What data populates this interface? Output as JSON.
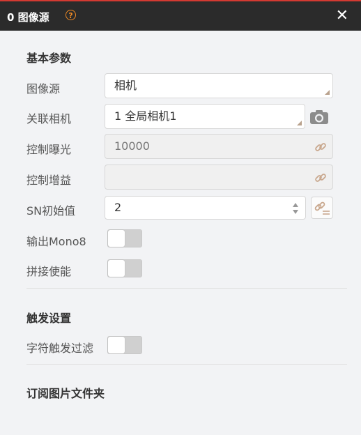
{
  "header": {
    "title": "0 图像源",
    "help_icon": "?",
    "close_icon": "✕"
  },
  "sections": {
    "basic": "基本参数",
    "trigger": "触发设置",
    "subscribe": "订阅图片文件夹"
  },
  "fields": {
    "image_source": {
      "label": "图像源",
      "value": "相机"
    },
    "camera": {
      "label": "关联相机",
      "value": "1 全局相机1"
    },
    "exposure": {
      "label": "控制曝光",
      "value": "10000"
    },
    "gain": {
      "label": "控制增益",
      "value": ""
    },
    "sn": {
      "label": "SN初始值",
      "value": "2"
    },
    "mono8": {
      "label": "输出Mono8",
      "on": false
    },
    "stitch": {
      "label": "拼接使能",
      "on": false
    },
    "char_filter": {
      "label": "字符触发过滤",
      "on": false
    }
  },
  "colors": {
    "accent": "#f08a24",
    "titlebar": "#2b2b2b",
    "topline": "#d43a32"
  }
}
